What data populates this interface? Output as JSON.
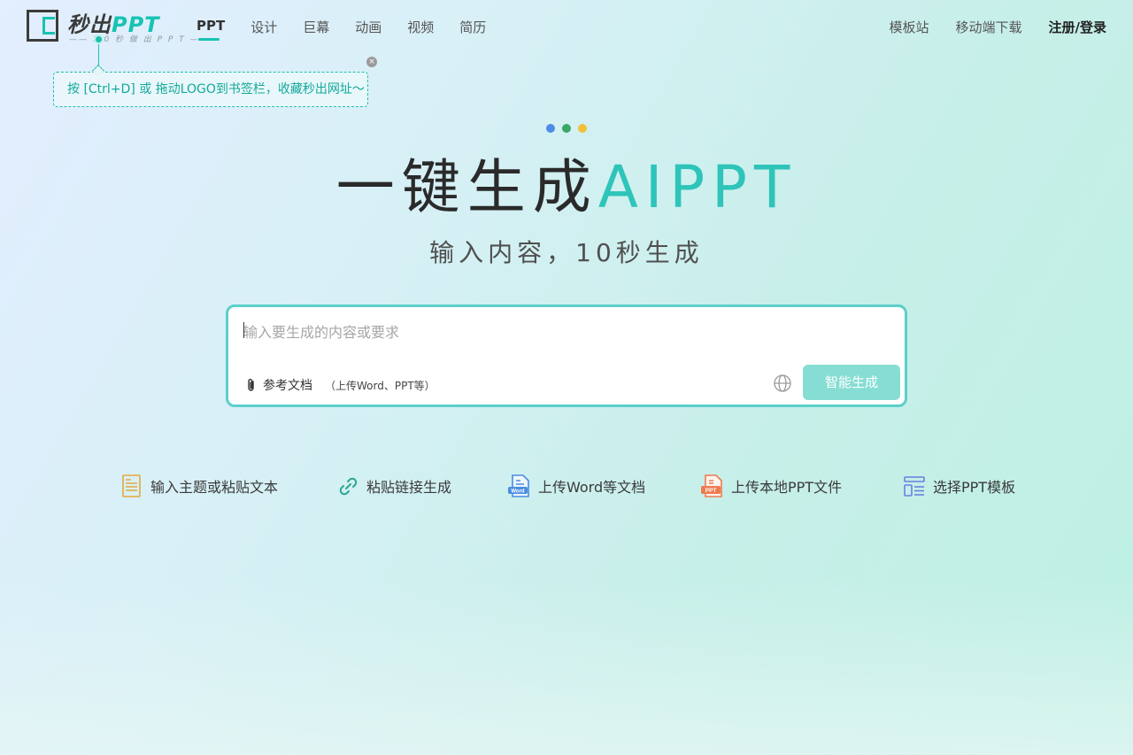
{
  "header": {
    "logo": {
      "name": "秒出",
      "name_accent": "PPT",
      "tagline": "—— 1 0 秒 做 出 P P T ——"
    },
    "nav": [
      "PPT",
      "设计",
      "巨幕",
      "动画",
      "视频",
      "简历"
    ],
    "nav_active": "PPT",
    "right_links": {
      "templates": "模板站",
      "mobile": "移动端下载",
      "login": "注册/登录"
    }
  },
  "tooltip": {
    "text": "按 [Ctrl+D] 或 拖动LOGO到书签栏，收藏秒出网址～",
    "close": "×"
  },
  "hero": {
    "dots": [
      "#4d8be8",
      "#3aa866",
      "#f2c038"
    ],
    "title": "一键生成",
    "title_accent": "AIPPT",
    "subtitle": "输入内容，10秒生成"
  },
  "input": {
    "placeholder": "输入要生成的内容或要求",
    "ref_doc_label": "参考文档",
    "ref_doc_hint": "（上传Word、PPT等）",
    "generate_button": "智能生成"
  },
  "options": [
    {
      "label": "输入主题或粘贴文本",
      "icon": "text-doc-icon"
    },
    {
      "label": "粘贴链接生成",
      "icon": "link-icon"
    },
    {
      "label": "上传Word等文档",
      "icon": "word-doc-icon"
    },
    {
      "label": "上传本地PPT文件",
      "icon": "ppt-file-icon"
    },
    {
      "label": "选择PPT模板",
      "icon": "template-icon"
    }
  ],
  "colors": {
    "accent": "#17c3b2",
    "button_disabled": "#86ddd3",
    "input_border": "#5ccfcb"
  }
}
